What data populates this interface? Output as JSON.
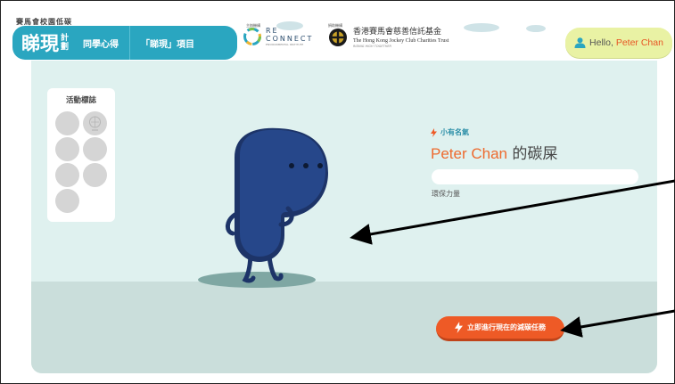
{
  "header": {
    "programme_title": "賽馬會校園低碳",
    "logo": {
      "main": "睇現",
      "sub_top": "計",
      "sub_bottom": "劃"
    },
    "nav": [
      {
        "label": "同學心得"
      },
      {
        "label": "「睇現」項目"
      }
    ],
    "organizer_label": "主辦機構",
    "organizer": {
      "line1": "RE",
      "line2": "CONNECT",
      "tagline": "ENVIRONMENTAL INSTITUTE"
    },
    "funder_label": "捐助機構",
    "funder": {
      "name_zh": "香港賽馬會慈善信託基金",
      "name_en": "The Hong Kong Jockey Club Charities Trust",
      "tagline": "RIDING HIGH TOGETHER"
    },
    "user": {
      "greeting": "Hello,",
      "name": "Peter Chan"
    }
  },
  "badges": {
    "title": "活動標誌",
    "count": 7,
    "items": [
      {
        "state": "unlocked-icon"
      },
      {
        "state": "locked"
      },
      {
        "state": "locked"
      },
      {
        "state": "locked"
      },
      {
        "state": "locked"
      },
      {
        "state": "locked"
      },
      {
        "state": "locked"
      }
    ]
  },
  "profile": {
    "level_label": "小有名氣",
    "name": "Peter Chan",
    "title_suffix": "的碳屎",
    "progress_label": "環保力量",
    "progress_fraction": 0.0
  },
  "mission": {
    "button_label": "立即進行現在的減碳任務"
  },
  "colors": {
    "brand_teal": "#2aa6c0",
    "accent_orange": "#ee5a26",
    "mascot_navy": "#24407a",
    "scene_bg": "#dff1ef",
    "hello_bg": "#e9f2a4"
  }
}
